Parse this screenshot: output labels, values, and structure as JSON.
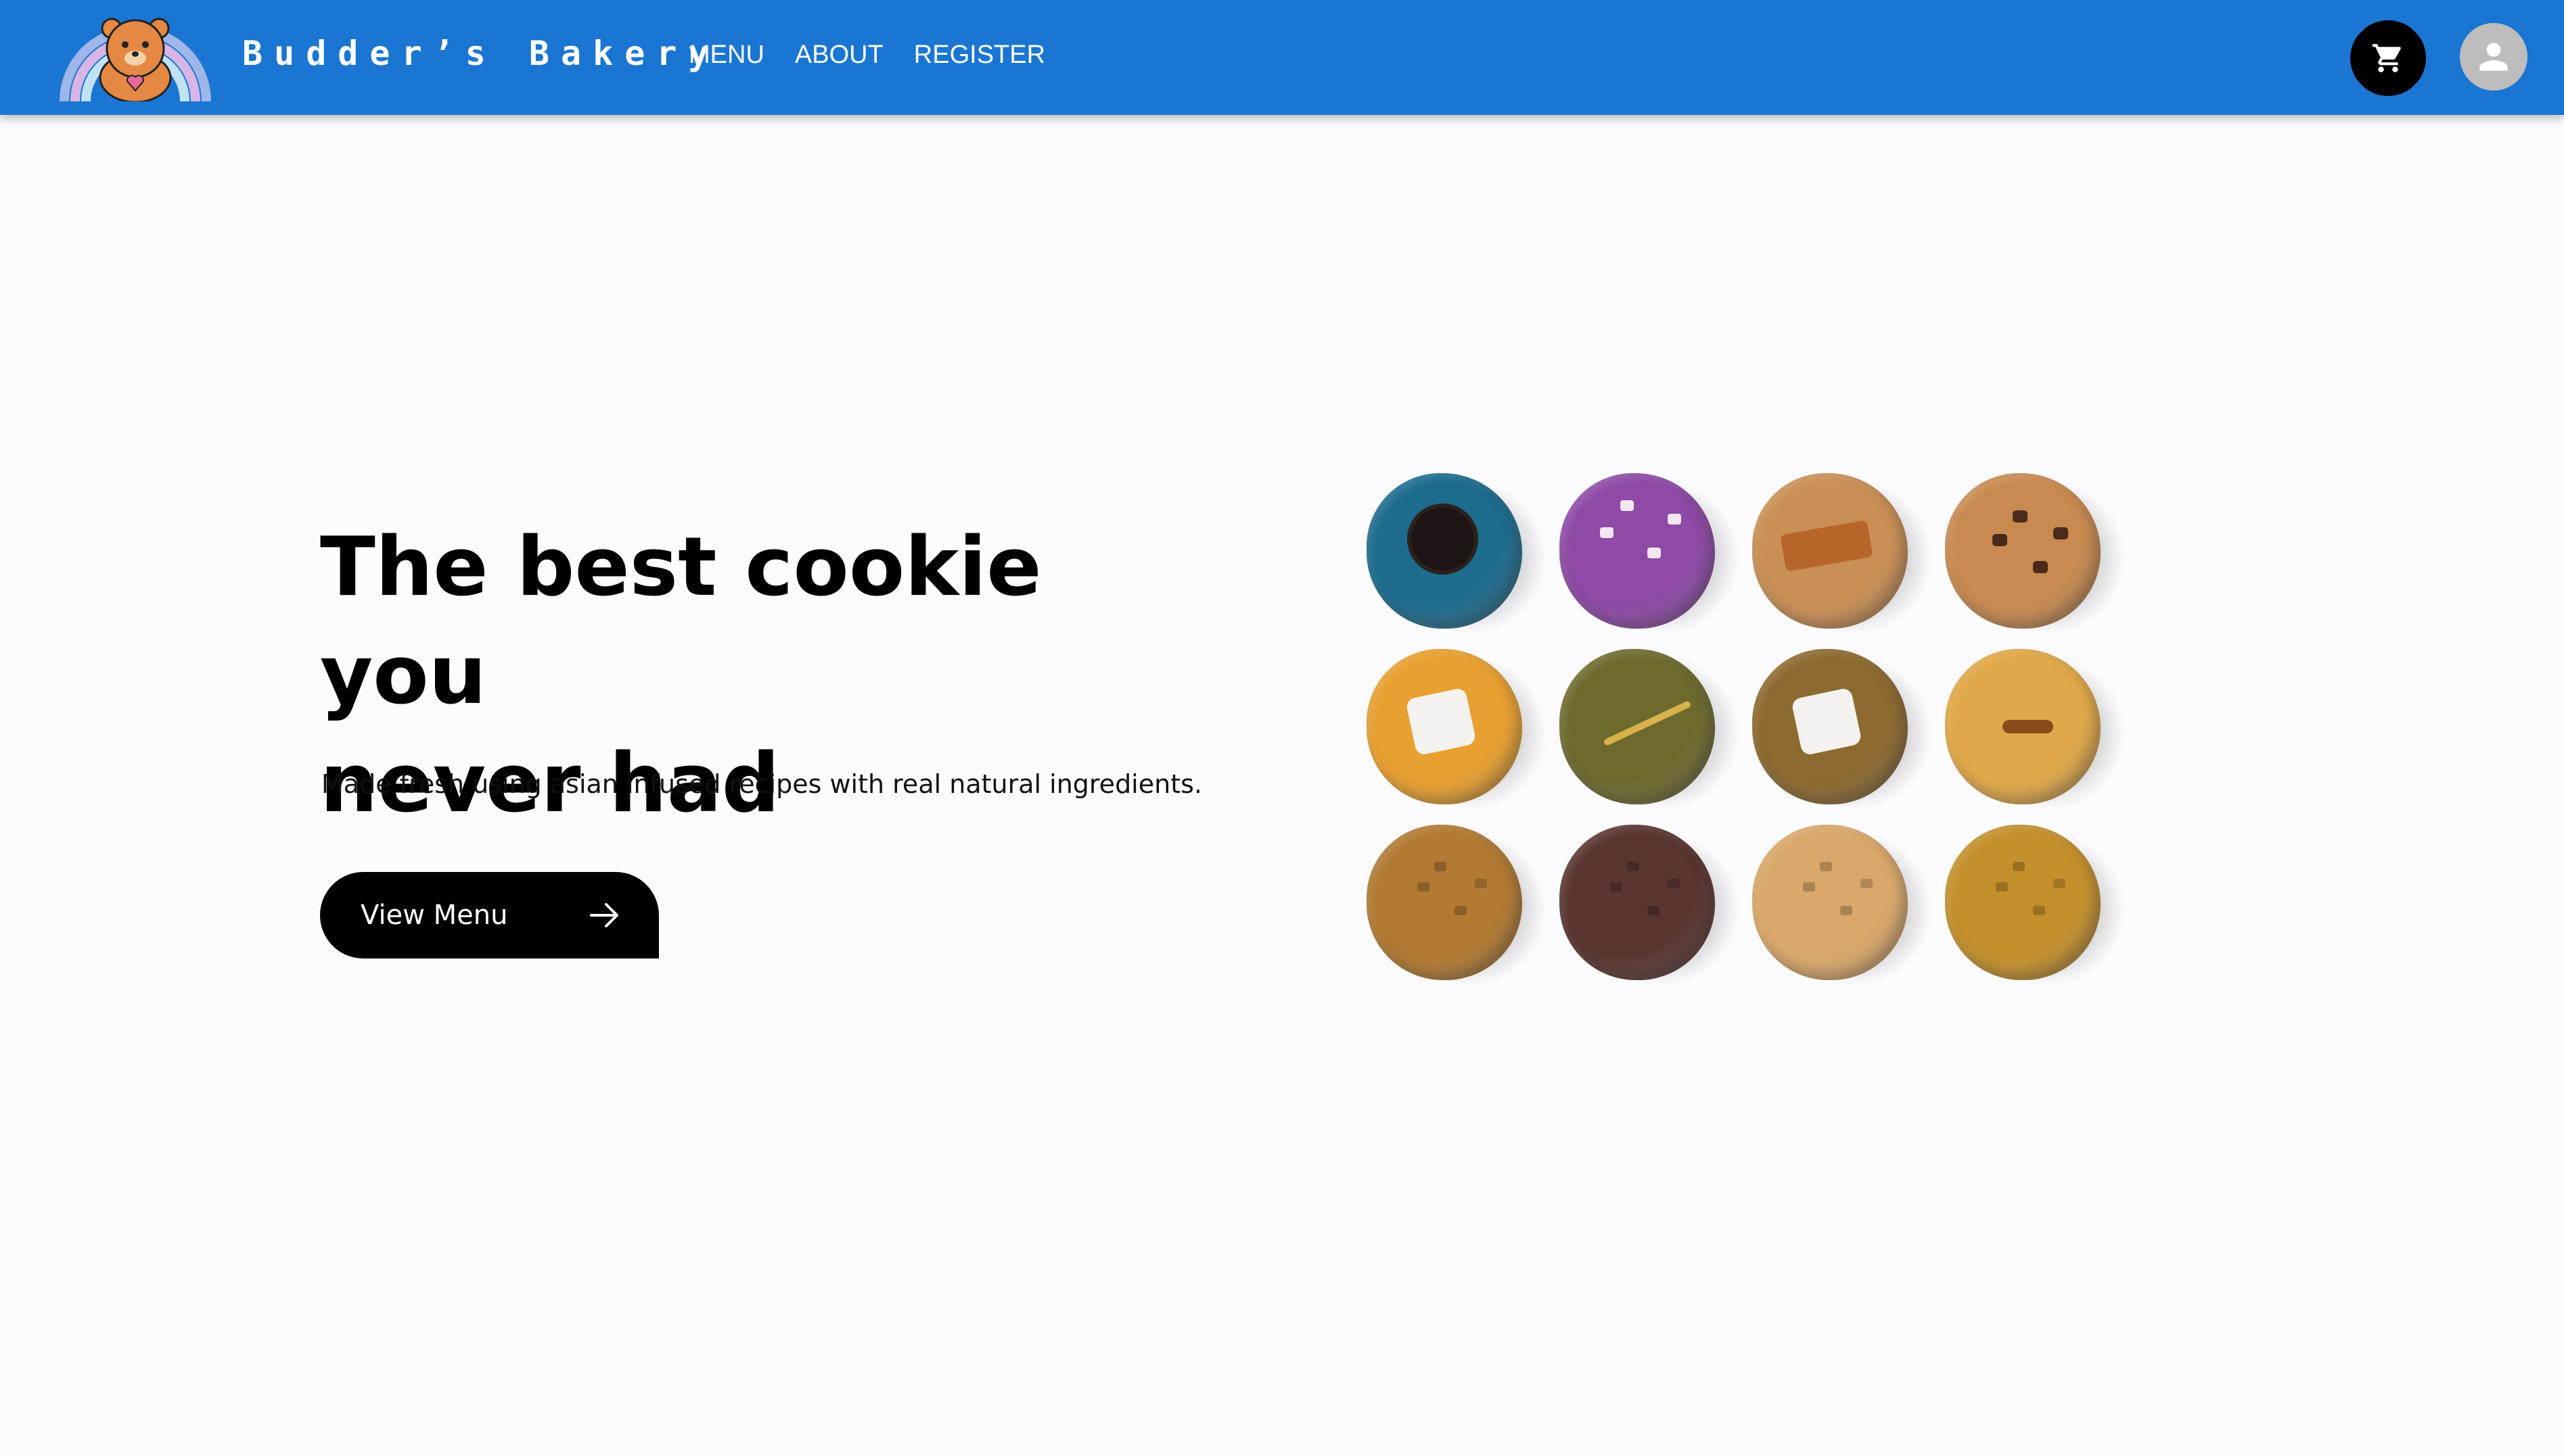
{
  "nav": {
    "brand": "Budder’s Bakery",
    "links": [
      "MENU",
      "ABOUT",
      "REGISTER"
    ]
  },
  "hero": {
    "title_line1": "The best cookie you",
    "title_line2": "never had",
    "subtitle": "Made fresh using asian infused recipes with real natural ingredients.",
    "cta_label": "View Menu"
  },
  "colors": {
    "navbar": "#1a76d2",
    "page_background": "#fcfbfd",
    "cta_background": "#000000",
    "avatar_background": "#bdbdbd"
  },
  "icons": [
    "bear-rainbow-logo",
    "cart-icon",
    "account-icon",
    "arrow-right-icon"
  ],
  "cookies": [
    {
      "name": "blue-oreo-cookie",
      "color": "#1d6c8e",
      "topping": "oreo"
    },
    {
      "name": "ube-white-chocolate-cookie",
      "color": "#8e4aa6",
      "topping": "white-chips"
    },
    {
      "name": "caramel-bar-cookie",
      "color": "#c98f55",
      "topping": "bar"
    },
    {
      "name": "chocolate-chip-cookie",
      "color": "#c88a50",
      "topping": "chips"
    },
    {
      "name": "sprinkle-marshmallow-cookie",
      "color": "#e8a030",
      "topping": "marshmallow"
    },
    {
      "name": "matcha-pocky-cookie",
      "color": "#6e6a2e",
      "topping": "pocky"
    },
    {
      "name": "smores-cookie",
      "color": "#8d6a30",
      "topping": "marshmallow"
    },
    {
      "name": "pretzel-cookie",
      "color": "#e0a848",
      "topping": "pretzel"
    },
    {
      "name": "pistachio-cookie",
      "color": "#b27a32",
      "topping": "none"
    },
    {
      "name": "double-chocolate-cookie",
      "color": "#5a3530",
      "topping": "none"
    },
    {
      "name": "white-chip-cookie",
      "color": "#d9a86a",
      "topping": "none"
    },
    {
      "name": "brown-butter-cookie",
      "color": "#c4902c",
      "topping": "none"
    }
  ]
}
